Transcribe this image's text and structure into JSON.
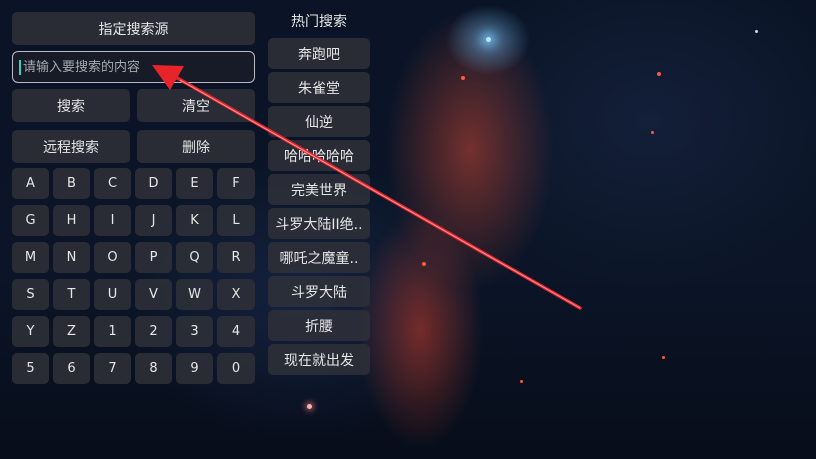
{
  "specify_source_label": "指定搜索源",
  "search_input": {
    "placeholder": "请输入要搜索的内容",
    "value": ""
  },
  "actions": {
    "search_label": "搜索",
    "clear_label": "清空",
    "remote_search_label": "远程搜索",
    "delete_label": "删除"
  },
  "keyboard": {
    "row1": [
      "A",
      "B",
      "C",
      "D",
      "E",
      "F"
    ],
    "row2": [
      "G",
      "H",
      "I",
      "J",
      "K",
      "L"
    ],
    "row3": [
      "M",
      "N",
      "O",
      "P",
      "Q",
      "R"
    ],
    "row4": [
      "S",
      "T",
      "U",
      "V",
      "W",
      "X"
    ],
    "row5": [
      "Y",
      "Z",
      "1",
      "2",
      "3",
      "4"
    ],
    "row6": [
      "5",
      "6",
      "7",
      "8",
      "9",
      "0"
    ]
  },
  "hot_search": {
    "title": "热门搜索",
    "items": [
      "奔跑吧",
      "朱雀堂",
      "仙逆",
      "哈哈哈哈哈",
      "完美世界",
      "斗罗大陆II绝..",
      "哪吒之魔童..",
      "斗罗大陆",
      "折腰",
      "现在就出发"
    ]
  },
  "annotation": {
    "color": "#e8242b"
  }
}
